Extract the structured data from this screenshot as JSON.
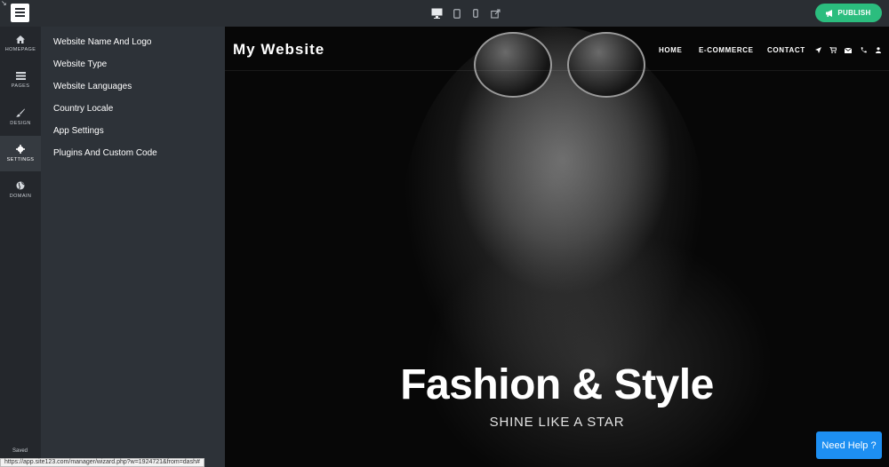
{
  "app": {
    "logo_icon": "site-logo-icon",
    "corner_mark": "↘"
  },
  "toolbar": {
    "device_icons": [
      "desktop-icon",
      "tablet-icon",
      "mobile-icon",
      "external-link-icon"
    ],
    "publish_label": "PUBLISH",
    "publish_icon": "megaphone-icon"
  },
  "rail": {
    "items": [
      {
        "label": "HOMEPAGE",
        "icon": "home-icon",
        "active": false
      },
      {
        "label": "PAGES",
        "icon": "pages-icon",
        "active": false
      },
      {
        "label": "DESIGN",
        "icon": "brush-icon",
        "active": false
      },
      {
        "label": "SETTINGS",
        "icon": "gear-icon",
        "active": true
      },
      {
        "label": "DOMAIN",
        "icon": "globe-icon",
        "active": false
      }
    ],
    "saved_label": "Saved"
  },
  "settings_menu": {
    "items": [
      "Website Name And Logo",
      "Website Type",
      "Website Languages",
      "Country Locale",
      "App Settings",
      "Plugins And Custom Code"
    ]
  },
  "preview": {
    "site_title": "My Website",
    "nav": [
      "HOME",
      "E-COMMERCE",
      "CONTACT"
    ],
    "nav_icons": [
      "location-arrow-icon",
      "cart-icon",
      "envelope-icon",
      "phone-icon",
      "user-icon"
    ],
    "hero_title": "Fashion & Style",
    "hero_subtitle": "SHINE LIKE A STAR"
  },
  "help_button": "Need Help ?",
  "status_url": "https://app.site123.com/manager/wizard.php?w=1924721&from=dash#",
  "colors": {
    "topbar": "#2a2e33",
    "rail": "#24272c",
    "panel": "#2d3238",
    "publish": "#2bbd7e",
    "help": "#1d8ff2"
  }
}
